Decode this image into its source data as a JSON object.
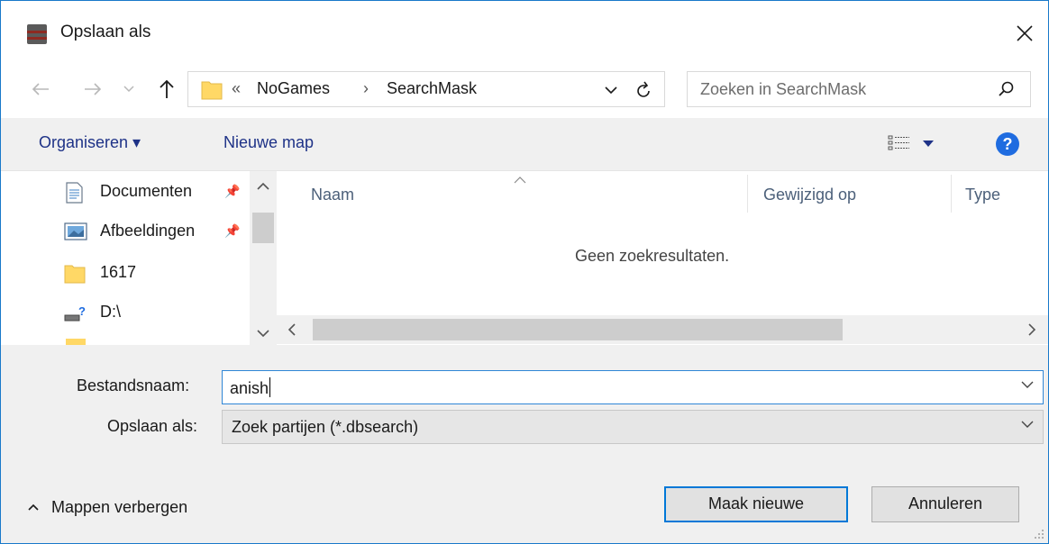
{
  "window": {
    "title": "Opslaan als",
    "app_icon": "database-icon"
  },
  "navigation": {
    "back_icon": "arrow-left-icon",
    "forward_icon": "arrow-right-icon",
    "recent_icon": "chevron-down-icon",
    "up_icon": "arrow-up-icon",
    "address": {
      "overflow": "«",
      "crumbs": [
        "NoGames",
        "SearchMask"
      ],
      "separator": "›"
    },
    "search_placeholder": "Zoeken in SearchMask"
  },
  "toolbar": {
    "organize_label": "Organiseren ▾",
    "new_folder_label": "Nieuwe map",
    "help_label": "?"
  },
  "nav_pane": {
    "items": [
      {
        "label": "Documenten",
        "icon": "documents-icon",
        "pinned": true
      },
      {
        "label": "Afbeeldingen",
        "icon": "pictures-icon",
        "pinned": true
      },
      {
        "label": "1617",
        "icon": "folder-icon",
        "pinned": false
      },
      {
        "label": "D:\\",
        "icon": "drive-icon",
        "pinned": false
      }
    ]
  },
  "file_list": {
    "columns": [
      "Naam",
      "Gewijzigd op",
      "Type"
    ],
    "sorted_column": "Naam",
    "empty_message": "Geen zoekresultaten."
  },
  "form": {
    "filename_label": "Bestandsnaam:",
    "filename_value": "anish",
    "filetype_label": "Opslaan als:",
    "filetype_value": "Zoek partijen (*.dbsearch)"
  },
  "footer": {
    "toggle_folders_label": "Mappen verbergen",
    "save_button": "Maak nieuwe",
    "cancel_button": "Annuleren"
  },
  "colors": {
    "accent": "#0078d7",
    "toolbar_bg": "#f0f0f0",
    "help_blue": "#1f6ce0",
    "folder_yellow": "#ffd866"
  }
}
